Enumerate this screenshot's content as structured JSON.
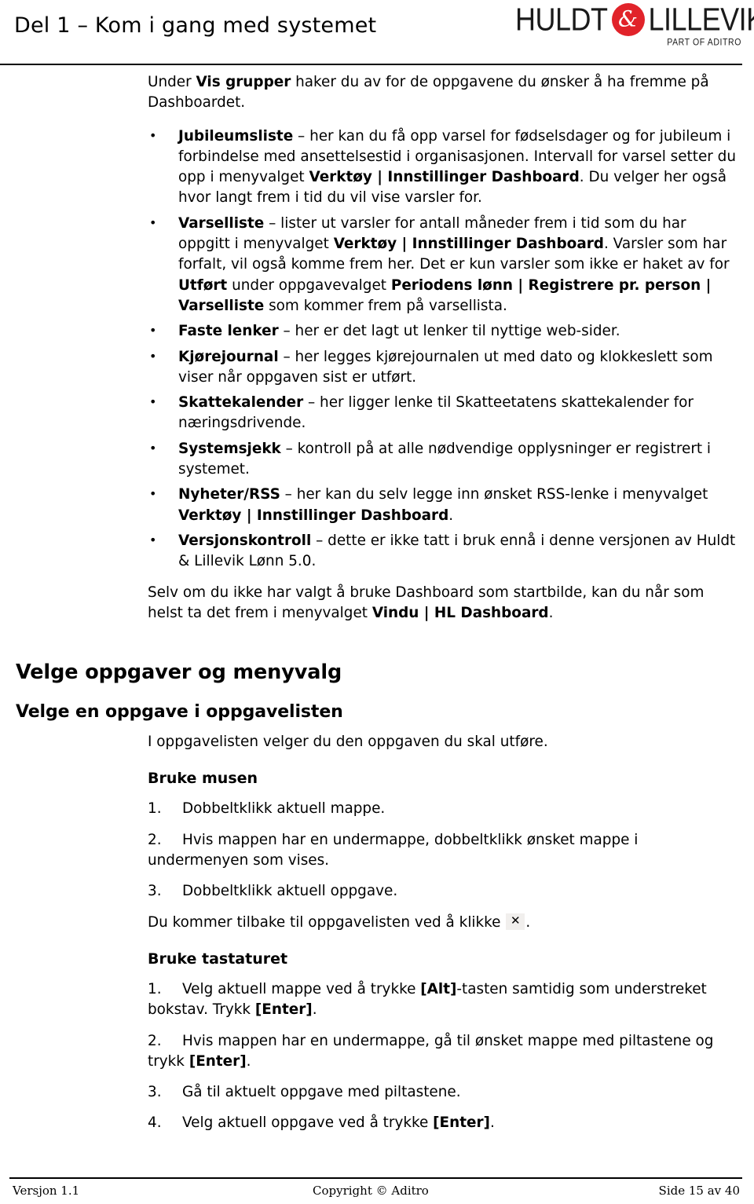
{
  "header": {
    "title": "Del 1 – Kom i gang med systemet",
    "logo": {
      "word1": "HULDT",
      "badge": "&",
      "word2": "LILLEVIK",
      "tagline": "PART OF ADITRO",
      "badge_color": "#e1232a"
    }
  },
  "body": {
    "intro": {
      "p1_a": "Under ",
      "p1_b": "Vis grupper",
      "p1_c": " haker du av for de oppgavene du ønsker å ha fremme på Dashboardet."
    },
    "bullets": [
      {
        "term": "Jubileumsliste",
        "t1": " – her kan du få opp varsel for fødselsdager og for jubileum i forbindelse med ansettelsestid i organisasjonen. Intervall for varsel setter du opp i menyvalget ",
        "b1": "Verktøy | Innstillinger Dashboard",
        "t2": ". Du velger her også hvor langt frem i tid du vil vise varsler for."
      },
      {
        "term": "Varselliste",
        "t1": " – lister ut varsler for antall måneder frem i tid som du har oppgitt i menyvalget ",
        "b1": "Verktøy | Innstillinger Dashboard",
        "t2": ". Varsler som har forfalt, vil også komme frem her. Det er kun varsler som ikke er haket av for ",
        "b2": "Utført",
        "t3": " under oppgavevalget ",
        "b3": "Periodens lønn | Registrere pr. person | Varselliste",
        "t4": " som kommer frem på varsellista."
      },
      {
        "term": "Faste lenker",
        "t1": " – her er det lagt ut lenker til nyttige web-sider."
      },
      {
        "term": "Kjørejournal",
        "t1": " – her legges kjørejournalen ut med dato og klokkeslett som viser når oppgaven sist er utført."
      },
      {
        "term": "Skattekalender",
        "t1": " – her ligger lenke til Skatteetatens skattekalender for næringsdrivende."
      },
      {
        "term": "Systemsjekk",
        "t1": " – kontroll på at alle nødvendige opplysninger er registrert i systemet."
      },
      {
        "term": "Nyheter/RSS",
        "t1": " – her kan du selv legge inn ønsket RSS-lenke i menyvalget ",
        "b1": "Verktøy | Innstillinger Dashboard",
        "t2": "."
      },
      {
        "term": "Versjonskontroll",
        "t1": " – dette er ikke tatt i bruk ennå i denne versjonen av Huldt & Lillevik Lønn 5.0."
      }
    ],
    "closing": {
      "t1": "Selv om du ikke har valgt å bruke Dashboard som startbilde, kan du når som helst ta det frem i menyvalget ",
      "b1": "Vindu | HL Dashboard",
      "t2": "."
    },
    "section_title": "Velge oppgaver og menyvalg",
    "subsection_title": "Velge en oppgave i oppgavelisten",
    "subsection_intro": "I oppgavelisten velger du den oppgaven du skal utføre.",
    "mouse": {
      "heading": "Bruke musen",
      "steps": [
        {
          "num": "1.",
          "text": "Dobbeltklikk aktuell mappe."
        },
        {
          "num": "2.",
          "text": "Hvis mappen har en undermappe, dobbeltklikk ønsket mappe i undermenyen som vises."
        },
        {
          "num": "3.",
          "text": "Dobbeltklikk aktuell oppgave."
        }
      ],
      "return_note_a": "Du kommer tilbake til oppgavelisten ved å klikke ",
      "return_note_icon": "✕",
      "return_note_b": "."
    },
    "keyboard": {
      "heading": "Bruke tastaturet",
      "steps": [
        {
          "num": "1.",
          "t1": "Velg aktuell mappe ved å trykke ",
          "b1": "[Alt]",
          "t2": "-tasten samtidig som understreket bokstav. Trykk ",
          "b2": "[Enter]",
          "t3": "."
        },
        {
          "num": "2.",
          "t1": "Hvis mappen har en undermappe, gå til ønsket mappe med piltastene og trykk ",
          "b1": "[Enter]",
          "t2": "."
        },
        {
          "num": "3.",
          "t1": "Gå til aktuelt oppgave med piltastene."
        },
        {
          "num": "4.",
          "t1": "Velg aktuell oppgave ved å trykke ",
          "b1": "[Enter]",
          "t2": "."
        }
      ]
    }
  },
  "footer": {
    "version": "Versjon 1.1",
    "copyright": "Copyright © Aditro",
    "page": "Side 15 av 40"
  }
}
